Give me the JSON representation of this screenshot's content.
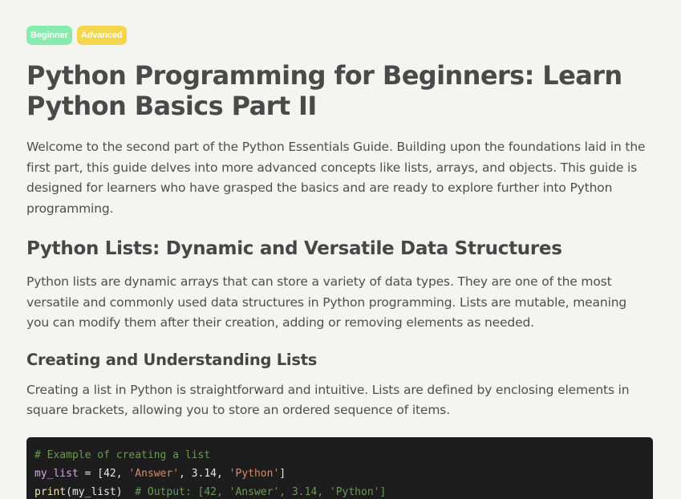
{
  "tags": [
    {
      "label": "Beginner",
      "color": "#86ebac"
    },
    {
      "label": "Advanced",
      "color": "#f4d64d"
    }
  ],
  "article": {
    "title": "Python Programming for Beginners: Learn Python Basics Part II",
    "intro": "Welcome to the second part of the Python Essentials Guide. Building upon the foundations laid in the first part, this guide delves into more advanced concepts like lists, arrays, and objects. This guide is designed for learners who have grasped the basics and are ready to explore further into Python programming.",
    "section_lists": {
      "heading": "Python Lists: Dynamic and Versatile Data Structures",
      "body": "Python lists are dynamic arrays that can store a variety of data types. They are one of the most versatile and commonly used data structures in Python programming. Lists are mutable, meaning you can modify them after their creation, adding or removing elements as needed."
    },
    "section_creating": {
      "heading": "Creating and Understanding Lists",
      "body": "Creating a list in Python is straightforward and intuitive. Lists are defined by enclosing elements in square brackets, allowing you to store an ordered sequence of items."
    }
  },
  "code": {
    "line1_comment": "# Example of creating a list",
    "line2": {
      "var": "my_list",
      "op": " = [",
      "n1": "42",
      "sep1": ", ",
      "s1": "'Answer'",
      "sep2": ", ",
      "n2": "3.14",
      "sep3": ", ",
      "s2": "'Python'",
      "close": "]"
    },
    "line3": {
      "func": "print",
      "args": "(my_list)",
      "gap": "  ",
      "comment": "# Output: [42, 'Answer', 3.14, 'Python']"
    }
  },
  "colors": {
    "background": "#f4f4f1",
    "code_background": "#1d1d1d",
    "comment": "#6a9a50",
    "string": "#d88a6b",
    "variable": "#d7a7e9",
    "function": "#f0e6a8"
  }
}
